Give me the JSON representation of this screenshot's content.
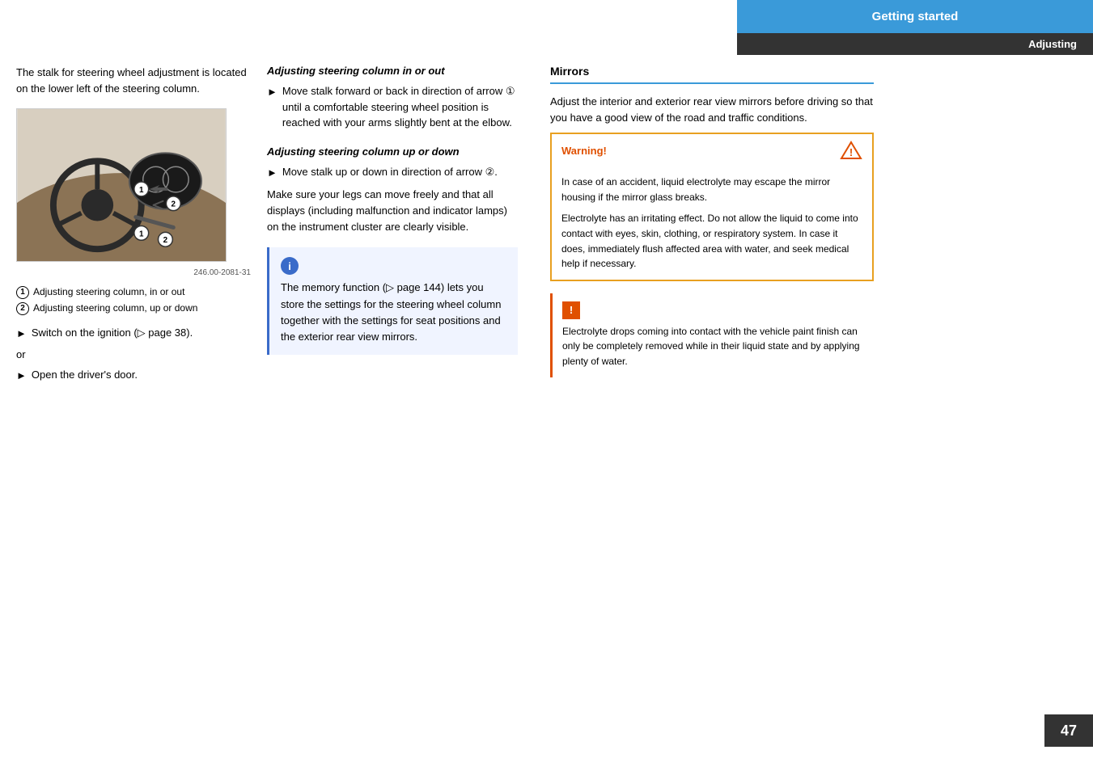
{
  "header": {
    "getting_started": "Getting started",
    "adjusting": "Adjusting"
  },
  "page_number": "47",
  "left_col": {
    "intro": "The stalk for steering wheel adjustment is located on the lower left of the steering column.",
    "image_label": "246.00-2081-31",
    "legend": [
      {
        "num": "1",
        "text": "Adjusting steering column, in or out"
      },
      {
        "num": "2",
        "text": "Adjusting steering column, up or down"
      }
    ],
    "bullet1": "Switch on the ignition (▷ page 38).",
    "or": "or",
    "bullet2": "Open the driver's door."
  },
  "middle_col": {
    "section1_heading": "Adjusting steering column in or out",
    "section1_bullet": "Move stalk forward or back in direction of arrow ① until a comfortable steering wheel position is reached with your arms slightly bent at the elbow.",
    "section2_heading": "Adjusting steering column up or down",
    "section2_bullet": "Move stalk up or down in direction of arrow ②.",
    "section2_body": "Make sure your legs can move freely and that all displays (including malfunction and indicator lamps) on the instrument cluster are clearly visible.",
    "info_body": "The memory function (▷ page 144) lets you store the settings for the steering wheel column together with the settings for seat positions and the exterior rear view mirrors."
  },
  "right_col": {
    "mirrors_heading": "Mirrors",
    "mirrors_body": "Adjust the interior and exterior rear view mirrors before driving so that you have a good view of the road and traffic conditions.",
    "warning_label": "Warning!",
    "warning_para1": "In case of an accident, liquid electrolyte may escape the mirror housing if the mirror glass breaks.",
    "warning_para2": "Electrolyte has an irritating effect. Do not allow the liquid to come into contact with eyes, skin, clothing, or respiratory system. In case it does, immediately flush affected area with water, and seek medical help if necessary.",
    "caution_body": "Electrolyte drops coming into contact with the vehicle paint finish can only be completely removed while in their liquid state and by applying plenty of water."
  }
}
